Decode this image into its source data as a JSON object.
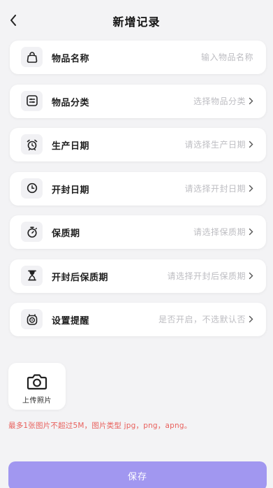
{
  "header": {
    "title": "新增记录",
    "back_icon": "chevron-left-icon"
  },
  "rows": [
    {
      "icon": "bag-icon",
      "label": "物品名称",
      "value": "输入物品名称",
      "arrow": false
    },
    {
      "icon": "category-icon",
      "label": "物品分类",
      "value": "选择物品分类",
      "arrow": true
    },
    {
      "icon": "alarm-clock-icon",
      "label": "生产日期",
      "value": "请选择生产日期",
      "arrow": true
    },
    {
      "icon": "clock-icon",
      "label": "开封日期",
      "value": "请选择开封日期",
      "arrow": true
    },
    {
      "icon": "stopwatch-icon",
      "label": "保质期",
      "value": "请选择保质期",
      "arrow": true
    },
    {
      "icon": "hourglass-icon",
      "label": "开封后保质期",
      "value": "请选择开封后保质期",
      "arrow": true
    },
    {
      "icon": "reminder-clock-icon",
      "label": "设置提醒",
      "value": "是否开启，不选默认否",
      "arrow": true
    }
  ],
  "upload": {
    "icon": "camera-icon",
    "label": "上传照片"
  },
  "hint": "最多1张图片不超过5M，图片类型 jpg，png，apng。",
  "save_label": "保存",
  "colors": {
    "accent": "#a197f0",
    "hint": "#e8605c",
    "placeholder": "#bdbdc2",
    "background": "#f3f3f5"
  }
}
